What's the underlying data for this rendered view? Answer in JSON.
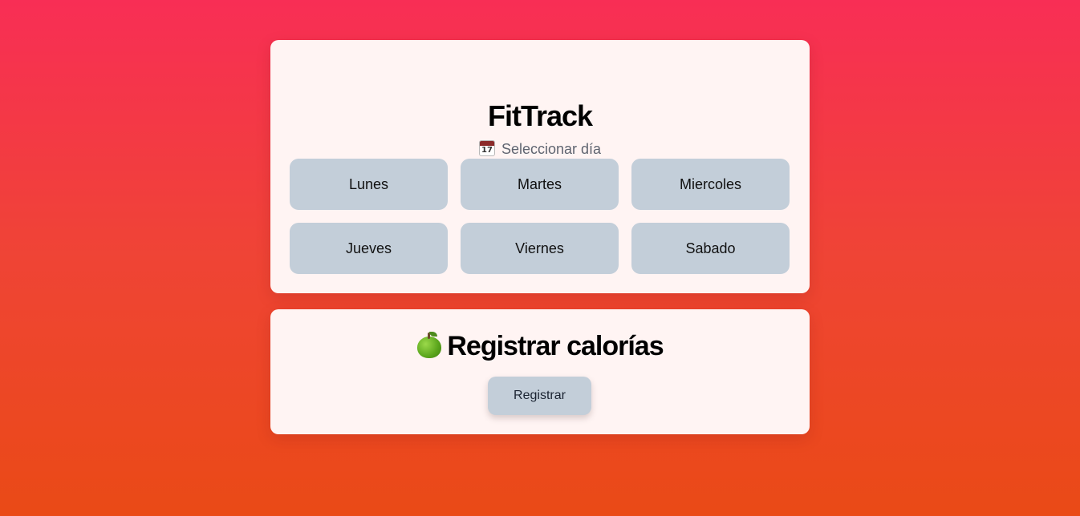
{
  "app": {
    "title": "FitTrack",
    "subtitle": "Seleccionar día",
    "subtitle_icon": "calendar-icon"
  },
  "days": [
    {
      "label": "Lunes"
    },
    {
      "label": "Martes"
    },
    {
      "label": "Miercoles"
    },
    {
      "label": "Jueves"
    },
    {
      "label": "Viernes"
    },
    {
      "label": "Sabado"
    }
  ],
  "calories": {
    "title": "Registrar calorías",
    "title_icon": "green-apple-icon",
    "button_label": "Registrar"
  },
  "colors": {
    "background_top": "#f82e55",
    "background_bottom": "#ea4a16",
    "card": "#fff4f3",
    "button": "#c3ced9"
  }
}
